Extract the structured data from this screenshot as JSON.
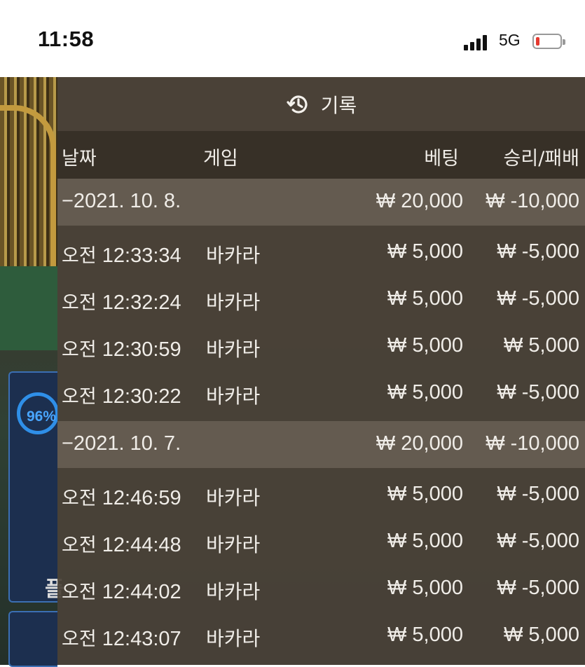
{
  "status_bar": {
    "time": "11:58",
    "network": "5G",
    "battery_color": "#e53a30"
  },
  "background": {
    "progress_percent_label": "96%",
    "partial_label": "플"
  },
  "history": {
    "icon": "history-clock-icon",
    "title": "기록",
    "columns": {
      "date": "날짜",
      "game": "게임",
      "bet": "베팅",
      "result": "승리/패배"
    },
    "groups": [
      {
        "date": "−2021. 10. 8.",
        "bet": "₩ 20,000",
        "result": "₩ -10,000",
        "rows": [
          {
            "ampm": "오전",
            "time": "12:33:34",
            "game": "바카라",
            "bet": "₩ 5,000",
            "result": "₩ -5,000"
          },
          {
            "ampm": "오전",
            "time": "12:32:24",
            "game": "바카라",
            "bet": "₩ 5,000",
            "result": "₩ -5,000"
          },
          {
            "ampm": "오전",
            "time": "12:30:59",
            "game": "바카라",
            "bet": "₩ 5,000",
            "result": "₩ 5,000"
          },
          {
            "ampm": "오전",
            "time": "12:30:22",
            "game": "바카라",
            "bet": "₩ 5,000",
            "result": "₩ -5,000"
          }
        ]
      },
      {
        "date": "−2021. 10. 7.",
        "bet": "₩ 20,000",
        "result": "₩ -10,000",
        "rows": [
          {
            "ampm": "오전",
            "time": "12:46:59",
            "game": "바카라",
            "bet": "₩ 5,000",
            "result": "₩ -5,000"
          },
          {
            "ampm": "오전",
            "time": "12:44:48",
            "game": "바카라",
            "bet": "₩ 5,000",
            "result": "₩ -5,000"
          },
          {
            "ampm": "오전",
            "time": "12:44:02",
            "game": "바카라",
            "bet": "₩ 5,000",
            "result": "₩ -5,000"
          },
          {
            "ampm": "오전",
            "time": "12:43:07",
            "game": "바카라",
            "bet": "₩ 5,000",
            "result": "₩ 5,000"
          }
        ]
      }
    ]
  }
}
